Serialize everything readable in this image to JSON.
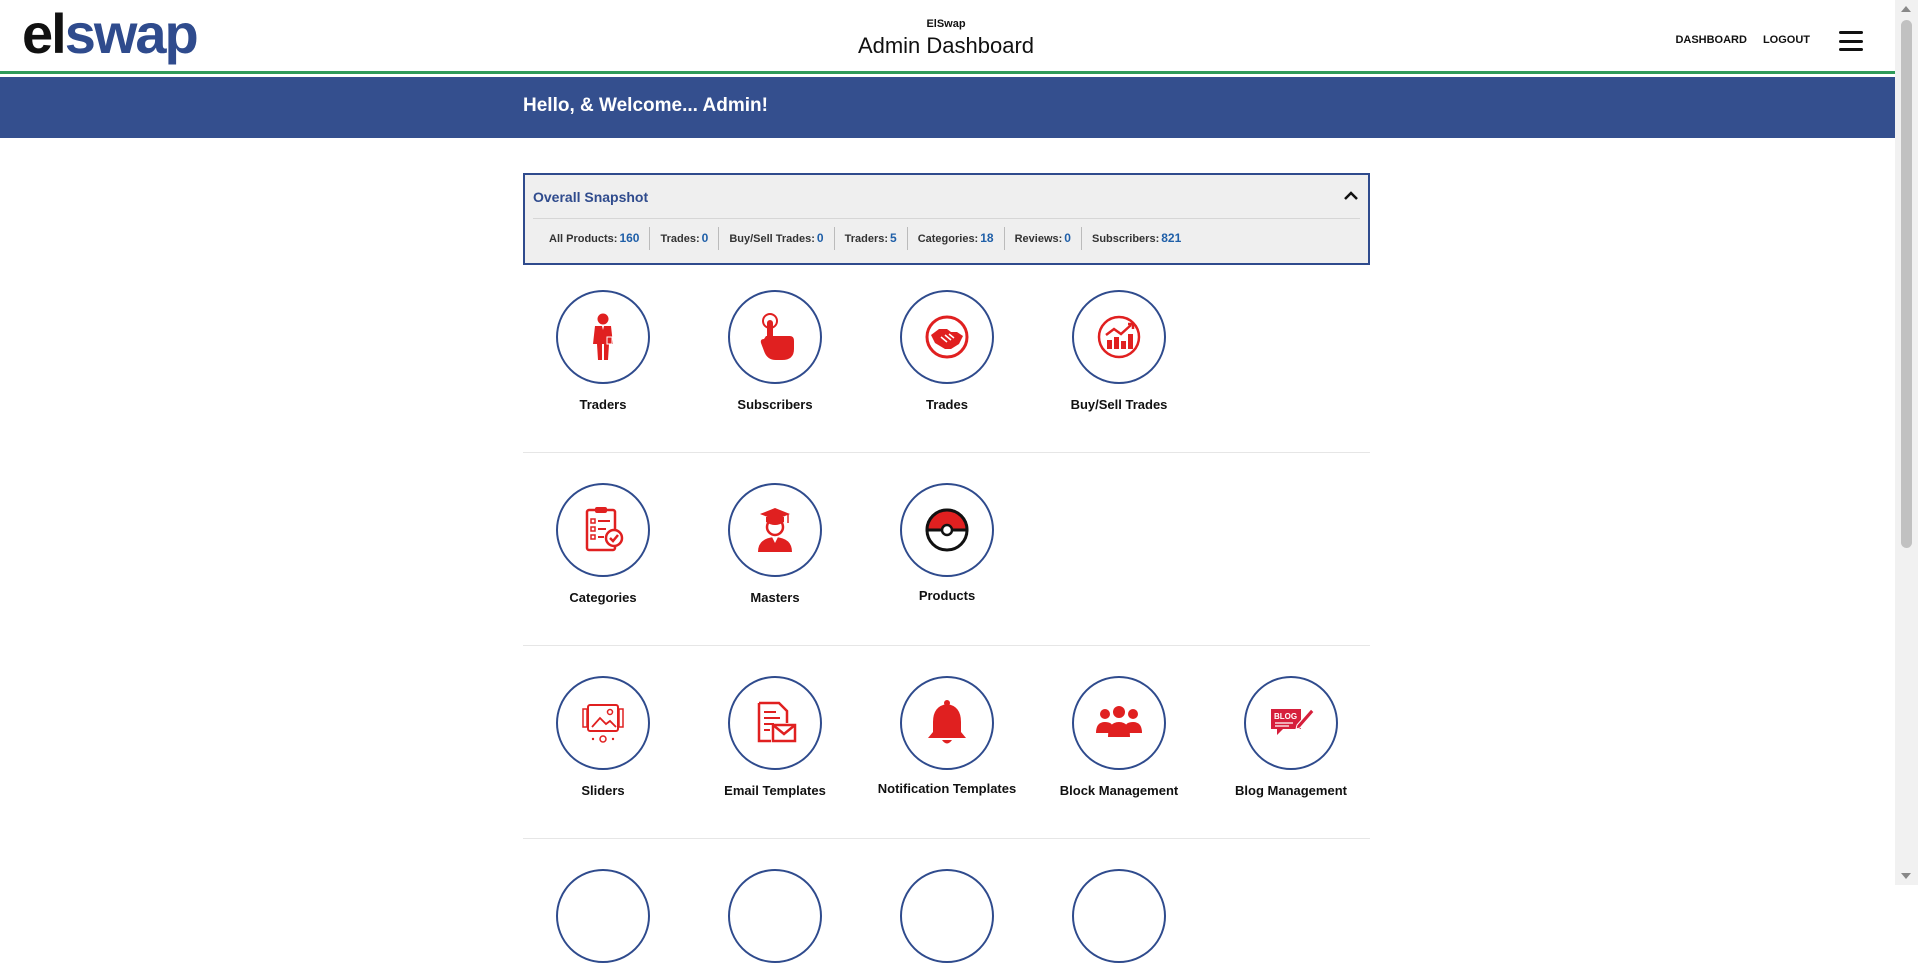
{
  "header": {
    "logo_prefix": "el",
    "logo_suffix": "swap",
    "app_name": "ElSwap",
    "page_title": "Admin Dashboard",
    "nav": [
      "DASHBOARD",
      "LOGOUT"
    ]
  },
  "welcome": "Hello, & Welcome... Admin!",
  "snapshot": {
    "title": "Overall Snapshot",
    "stats": [
      {
        "label": "All Products:",
        "value": "160"
      },
      {
        "label": "Trades:",
        "value": "0"
      },
      {
        "label": "Buy/Sell Trades:",
        "value": "0"
      },
      {
        "label": "Traders:",
        "value": "5"
      },
      {
        "label": "Categories:",
        "value": "18"
      },
      {
        "label": "Reviews:",
        "value": "0"
      },
      {
        "label": "Subscribers:",
        "value": "821"
      }
    ]
  },
  "tiles": {
    "row1": [
      {
        "label": "Traders",
        "icon": "trader-icon"
      },
      {
        "label": "Subscribers",
        "icon": "tap-finger-icon"
      },
      {
        "label": "Trades",
        "icon": "handshake-icon"
      },
      {
        "label": "Buy/Sell Trades",
        "icon": "growth-chart-icon"
      }
    ],
    "row2": [
      {
        "label": "Categories",
        "icon": "checklist-icon"
      },
      {
        "label": "Masters",
        "icon": "graduate-icon"
      },
      {
        "label": "Products",
        "icon": "pokeball-icon"
      }
    ],
    "row3": [
      {
        "label": "Sliders",
        "icon": "slider-icon"
      },
      {
        "label": "Email Templates",
        "icon": "email-document-icon"
      },
      {
        "label": "Notification Templates",
        "icon": "bell-icon"
      },
      {
        "label": "Block Management",
        "icon": "group-icon"
      },
      {
        "label": "Blog Management",
        "icon": "blog-icon"
      }
    ]
  },
  "colors": {
    "brand_blue": "#344f8e",
    "accent_red": "#e02020",
    "value_blue": "#1f5fa8"
  }
}
